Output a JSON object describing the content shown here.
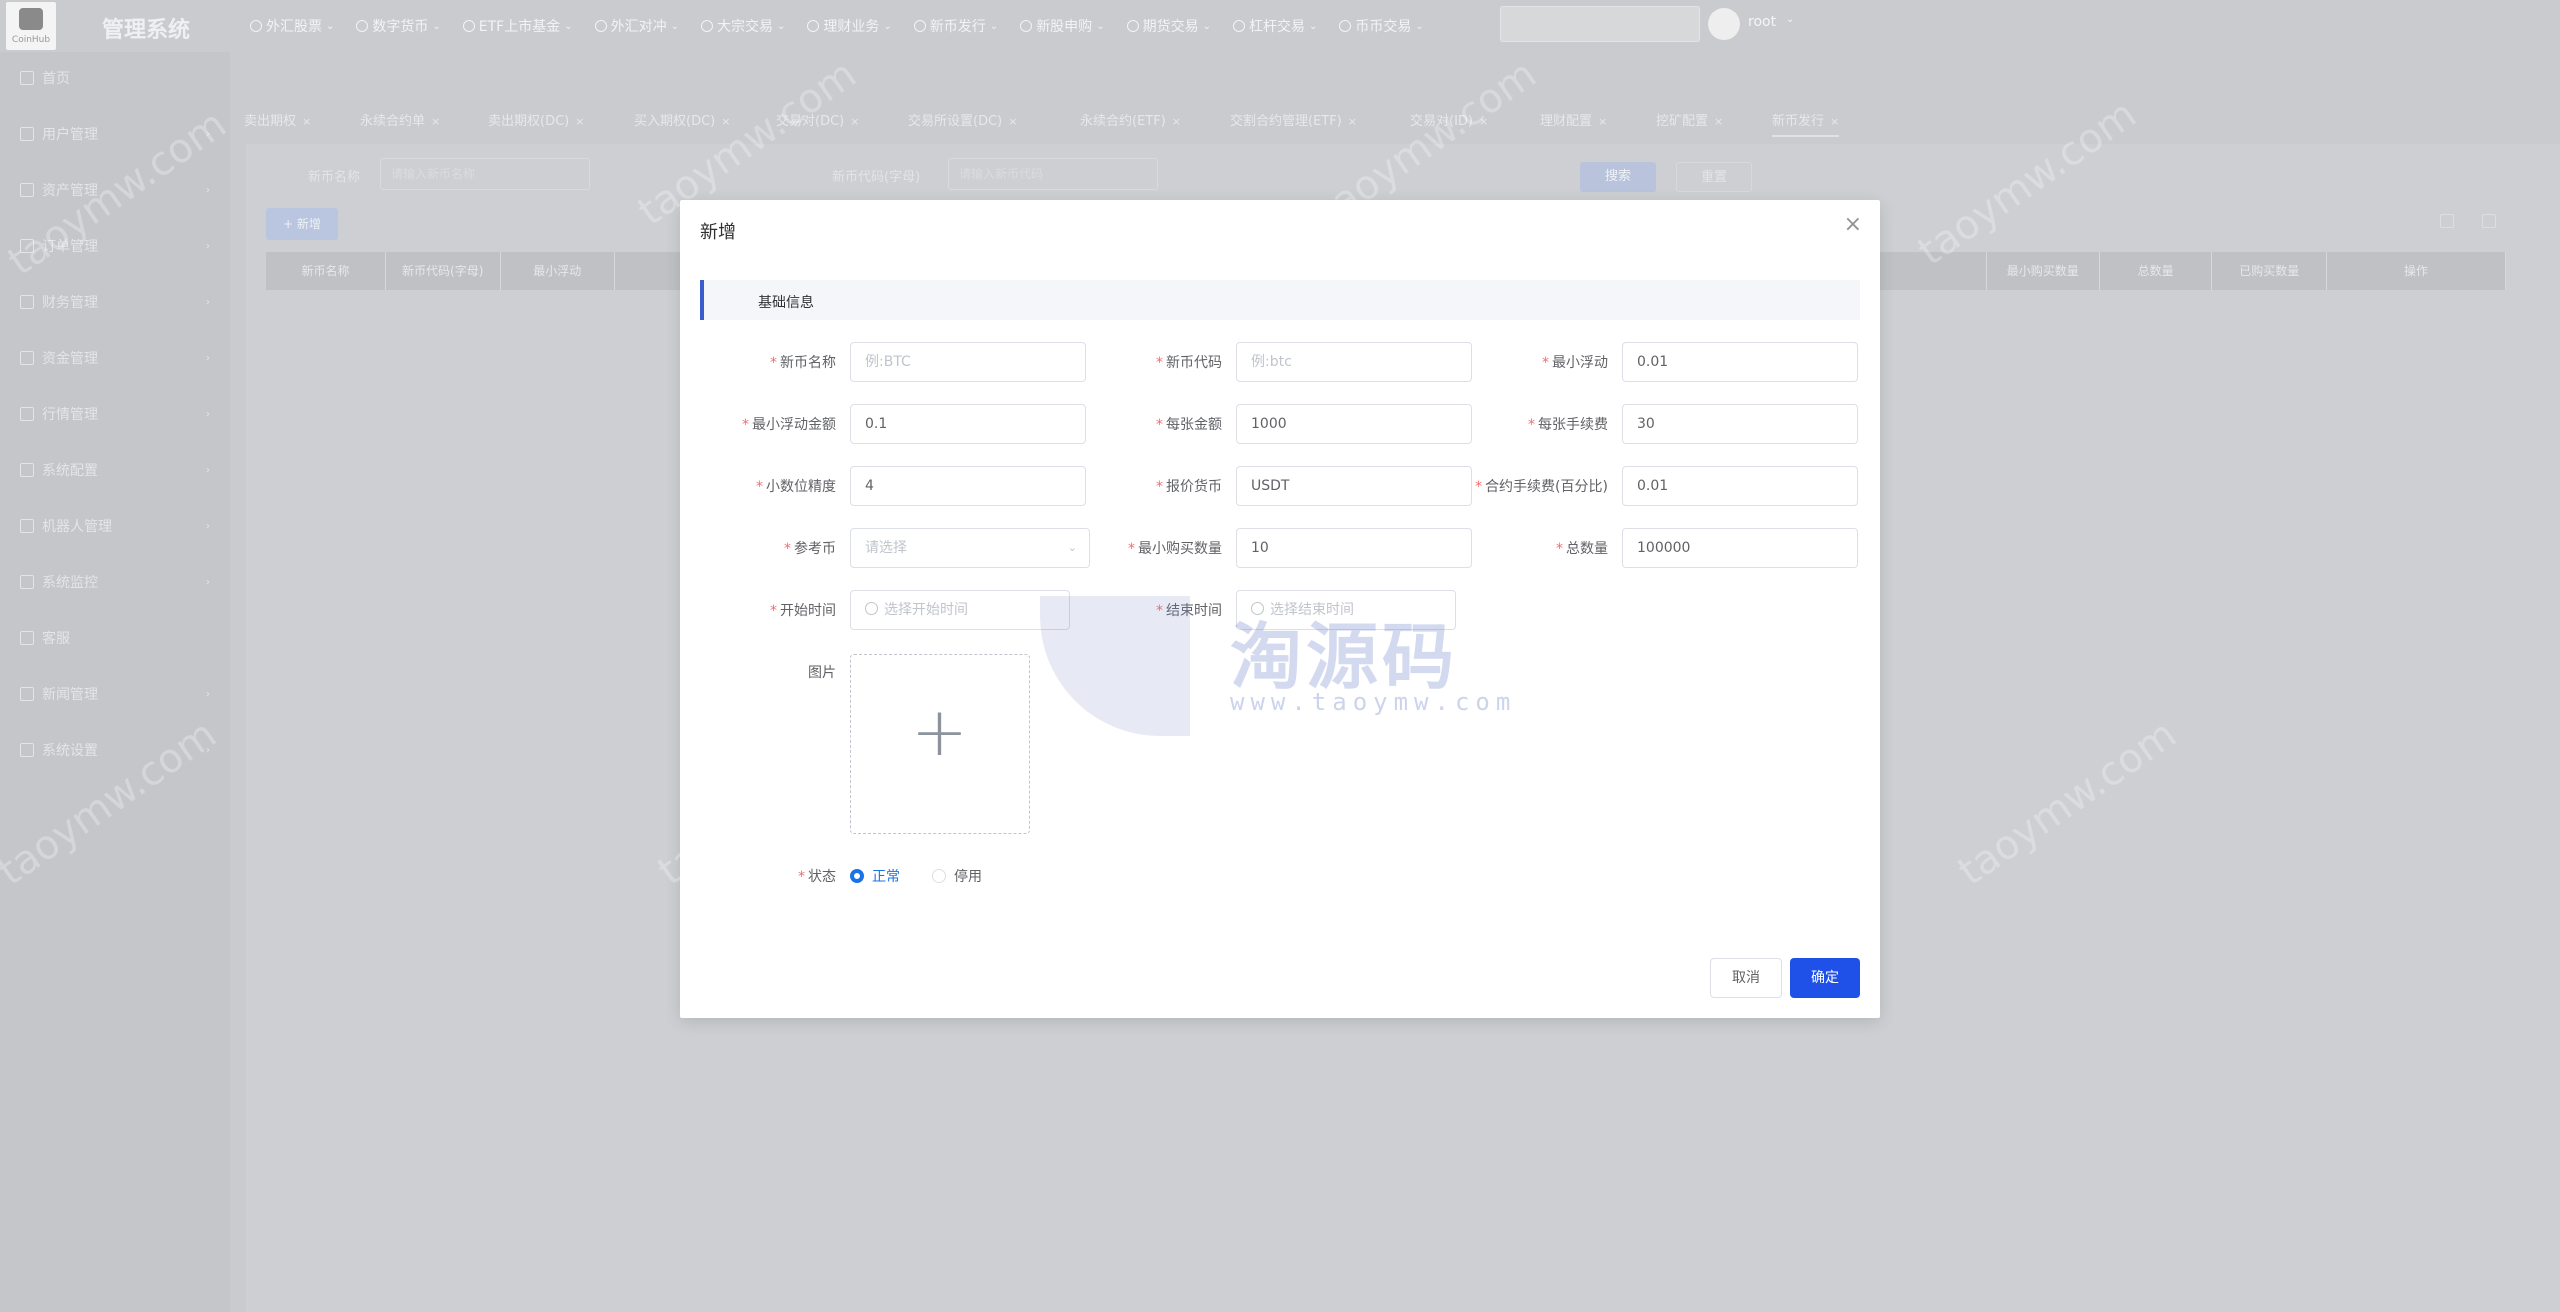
{
  "topbar": {
    "logo_text": "CoinHub",
    "brand": "管理系统",
    "nav": [
      "外汇股票",
      "数字货币",
      "ETF上市基金",
      "外汇对冲",
      "大宗交易",
      "理财业务",
      "新币发行",
      "新股申购",
      "期货交易",
      "杠杆交易",
      "币币交易"
    ],
    "search_placeholder": "",
    "user": "root"
  },
  "sidebar": {
    "items": [
      "首页",
      "用户管理",
      "资产管理",
      "订单管理",
      "财务管理",
      "资金管理",
      "行情管理",
      "系统配置",
      "机器人管理",
      "系统监控",
      "客服",
      "新闻管理",
      "系统设置"
    ]
  },
  "tabs": [
    "卖出期权",
    "永续合约单",
    "卖出期权(DC)",
    "买入期权(DC)",
    "交易对(DC)",
    "交易所设置(DC)",
    "永续合约(ETF)",
    "交割合约管理(ETF)",
    "交易对(ID)",
    "理财配置",
    "挖矿配置",
    "新币发行"
  ],
  "query": {
    "name_label": "新币名称",
    "name_placeholder": "请输入新币名称",
    "code_label": "新币代码(字母)",
    "code_placeholder": "请输入新币代码",
    "search_btn": "搜索",
    "reset_btn": "重置"
  },
  "list": {
    "add_btn": "+ 新增",
    "columns": [
      "新币名称",
      "新币代码(字母)",
      "最小浮动",
      "",
      "",
      "",
      "",
      "",
      "",
      "",
      "",
      "",
      "",
      "最小购买数量",
      "总数量",
      "已购买数量",
      "操作"
    ]
  },
  "modal": {
    "title": "新增",
    "section": "基础信息",
    "fields": {
      "coin_name": {
        "label": "新币名称",
        "value": "",
        "placeholder": "例:BTC"
      },
      "coin_code": {
        "label": "新币代码",
        "value": "",
        "placeholder": "例:btc"
      },
      "min_float": {
        "label": "最小浮动",
        "value": "0.01"
      },
      "min_float_amount": {
        "label": "最小浮动金额",
        "value": "0.1"
      },
      "per_amount": {
        "label": "每张金额",
        "value": "1000"
      },
      "per_fee": {
        "label": "每张手续费",
        "value": "30"
      },
      "decimal_precision": {
        "label": "小数位精度",
        "value": "4"
      },
      "quote_currency": {
        "label": "报价货币",
        "value": "USDT"
      },
      "contract_fee": {
        "label": "合约手续费(百分比)",
        "value": "0.01"
      },
      "ref_coin": {
        "label": "参考币",
        "value": "",
        "placeholder": "请选择"
      },
      "min_buy": {
        "label": "最小购买数量",
        "value": "10"
      },
      "total": {
        "label": "总数量",
        "value": "100000"
      },
      "start_time": {
        "label": "开始时间",
        "placeholder": "选择开始时间"
      },
      "end_time": {
        "label": "结束时间",
        "placeholder": "选择结束时间"
      }
    },
    "image_label": "图片",
    "status_label": "状态",
    "status_options": [
      "正常",
      "停用"
    ],
    "status_selected": "正常",
    "cancel_btn": "取消",
    "ok_btn": "确定"
  },
  "watermark": {
    "cn": "淘源码",
    "url": "www.taoymw.com",
    "repeat": "taoymw.com"
  },
  "colors": {
    "primary": "#1f51e8",
    "required": "#f56c6c",
    "section_bar": "#3a5ccc"
  }
}
